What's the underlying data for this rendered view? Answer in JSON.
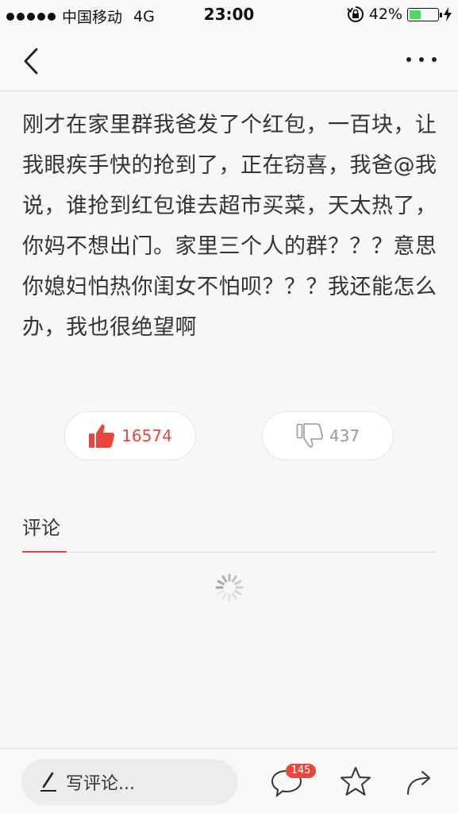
{
  "status_bar": {
    "carrier": "中国移动",
    "network": "4G",
    "time": "23:00",
    "battery_percent": "42%",
    "battery_level": 0.42
  },
  "post": {
    "text": "刚才在家里群我爸发了个红包，一百块，让我眼疾手快的抢到了，正在窃喜，我爸@我说，谁抢到红包谁去超市买菜，天太热了，你妈不想出门。家里三个人的群？？？意思你媳妇怕热你闺女不怕呗？？？我还能怎么办，我也很绝望啊"
  },
  "votes": {
    "up_count": "16574",
    "down_count": "437"
  },
  "comments": {
    "label": "评论"
  },
  "bottom_bar": {
    "write_placeholder": "写评论...",
    "comment_badge": "145"
  },
  "colors": {
    "accent": "#e8453c",
    "battery_green": "#4cd964"
  },
  "icons": [
    "back-arrow-icon",
    "more-icon",
    "thumb-up-icon",
    "thumb-down-icon",
    "loading-spinner-icon",
    "pencil-icon",
    "comment-bubble-icon",
    "star-icon",
    "share-icon",
    "orientation-lock-icon",
    "charging-bolt-icon"
  ]
}
